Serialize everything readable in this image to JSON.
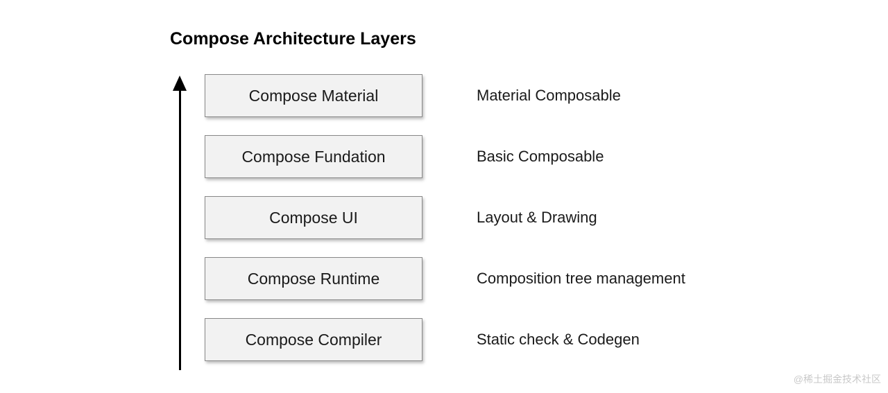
{
  "title": "Compose Architecture Layers",
  "layers": [
    {
      "name": "Compose Material",
      "description": "Material Composable"
    },
    {
      "name": "Compose Fundation",
      "description": "Basic Composable"
    },
    {
      "name": "Compose UI",
      "description": "Layout & Drawing"
    },
    {
      "name": "Compose Runtime",
      "description": "Composition tree management"
    },
    {
      "name": "Compose Compiler",
      "description": "Static check & Codegen"
    }
  ],
  "watermark": "@稀土掘金技术社区"
}
